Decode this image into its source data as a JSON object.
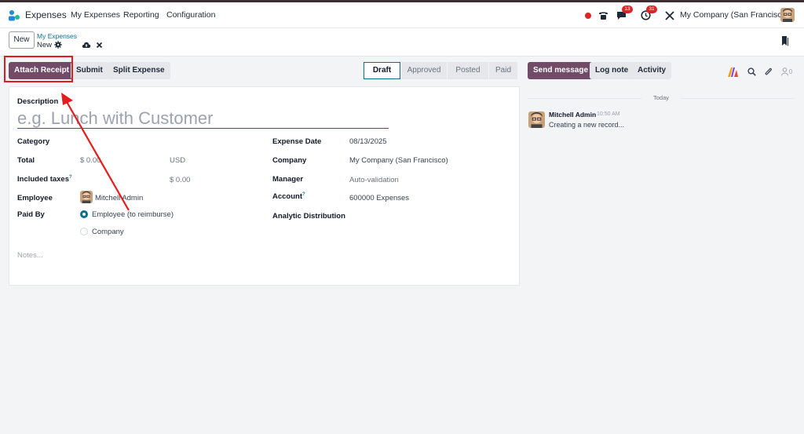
{
  "navbar": {
    "app_name": "Expenses",
    "menu": [
      "My Expenses",
      "Reporting",
      "Configuration"
    ],
    "messages_count": "13",
    "activities_count": "31",
    "company": "My Company (San Francisco)"
  },
  "control": {
    "new_label": "New",
    "breadcrumb_parent": "My Expenses",
    "breadcrumb_current": "New"
  },
  "actions": {
    "attach_receipt": "Attach Receipt",
    "submit": "Submit",
    "split_expense": "Split Expense"
  },
  "statusbar": {
    "stages": [
      "Draft",
      "Approved",
      "Posted",
      "Paid"
    ],
    "active": "Draft"
  },
  "chatter_buttons": {
    "send_message": "Send message",
    "log_note": "Log note",
    "activity": "Activity",
    "followers_count": "0"
  },
  "form": {
    "description_label": "Description",
    "description_placeholder": "e.g. Lunch with Customer",
    "category_label": "Category",
    "total_label": "Total",
    "total_value": "$ 0.00",
    "currency": "USD",
    "included_taxes_label": "Included taxes",
    "help_mark": "?",
    "included_taxes_value": "$ 0.00",
    "employee_label": "Employee",
    "employee_value": "Mitchell Admin",
    "paid_by_label": "Paid By",
    "paid_by_options": [
      "Employee (to reimburse)",
      "Company"
    ],
    "paid_by_selected": "Employee (to reimburse)",
    "expense_date_label": "Expense Date",
    "expense_date_value": "08/13/2025",
    "company_label": "Company",
    "company_value": "My Company (San Francisco)",
    "manager_label": "Manager",
    "manager_placeholder": "Auto-validation",
    "account_label": "Account",
    "account_value": "600000 Expenses",
    "analytic_label": "Analytic Distribution",
    "notes_placeholder": "Notes..."
  },
  "chatter": {
    "date_separator": "Today",
    "messages": [
      {
        "author": "Mitchell Admin",
        "time": "10:50 AM",
        "body": "Creating a new record..."
      }
    ]
  },
  "colors": {
    "primary": "#714b67",
    "link": "#0d6e8a",
    "highlight": "#e11d1d",
    "badge": "#dc2626",
    "record_dot": "#dc2626"
  },
  "icons": [
    "expenses-app-icon",
    "record-dot-icon",
    "phone-icon",
    "chat-icon",
    "clock-icon",
    "tools-icon",
    "gear-icon",
    "cloud-upload-icon",
    "close-icon",
    "bookmark-icon",
    "ai-icon",
    "search-icon",
    "paperclip-icon",
    "follower-icon"
  ]
}
